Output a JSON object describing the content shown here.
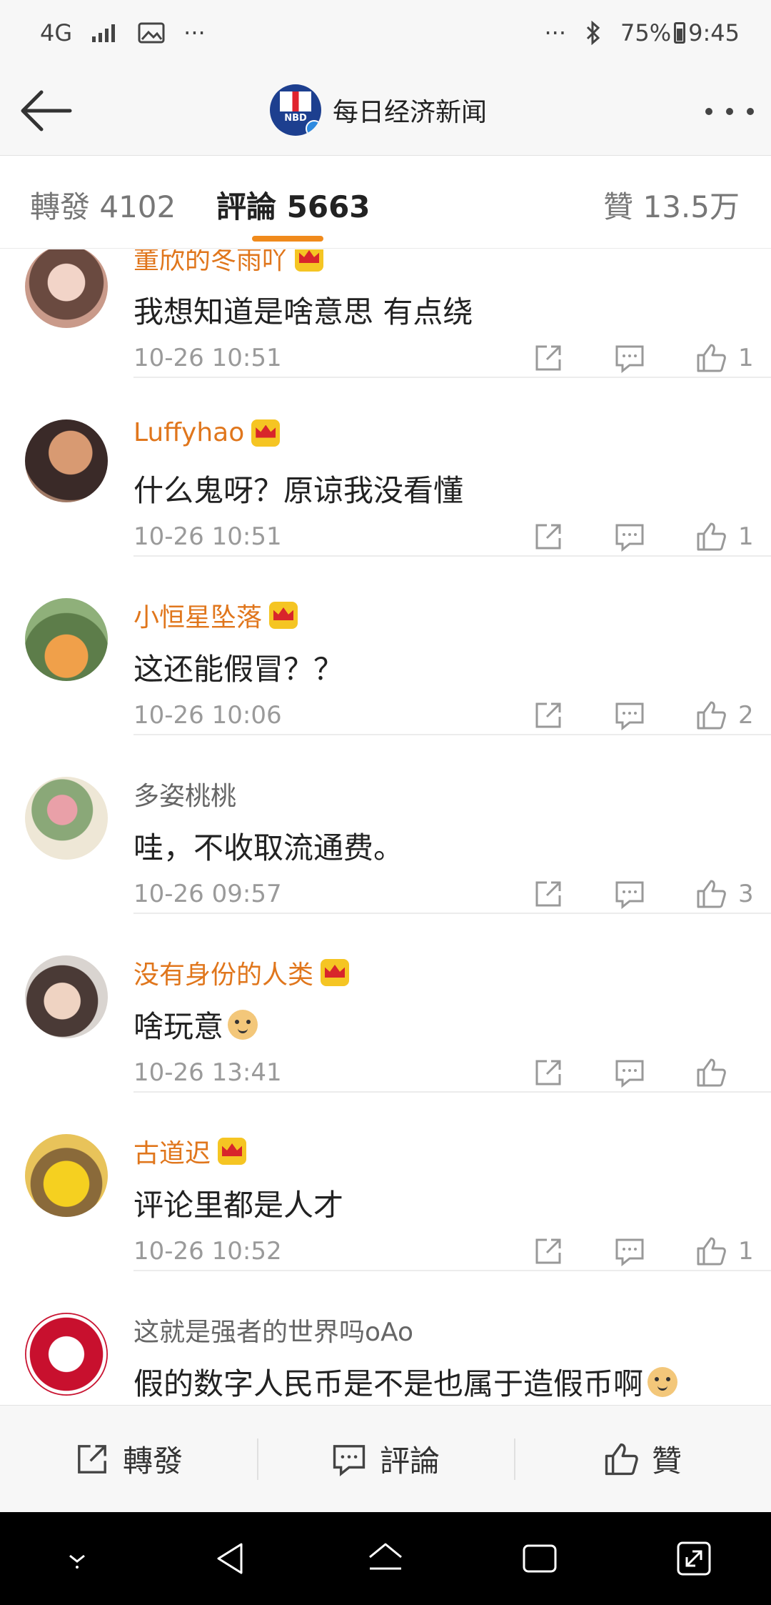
{
  "status_bar": {
    "network": "4G",
    "dots_left": "···",
    "dots_right": "···",
    "battery": "75%",
    "time": "9:45"
  },
  "header": {
    "logo_text": "NBD",
    "title": "每日经济新闻"
  },
  "tabs": [
    {
      "label": "轉發 4102"
    },
    {
      "label": "評論 5663"
    },
    {
      "label": "贊 13.5万"
    }
  ],
  "comments": [
    {
      "name": "董欣的冬雨吖",
      "vip": true,
      "text": "我想知道是啥意思 有点绕",
      "time": "10-26 10:51",
      "likes": "1",
      "emoji": false
    },
    {
      "name": "Luffyhao",
      "vip": true,
      "text": "什么鬼呀？原谅我没看懂",
      "time": "10-26 10:51",
      "likes": "1",
      "emoji": false
    },
    {
      "name": "小恒星坠落",
      "vip": true,
      "text": "这还能假冒？？",
      "time": "10-26 10:06",
      "likes": "2",
      "emoji": false
    },
    {
      "name": "多姿桃桃",
      "vip": false,
      "text": "哇，不收取流通费。",
      "time": "10-26 09:57",
      "likes": "3",
      "emoji": false
    },
    {
      "name": "没有身份的人类",
      "vip": true,
      "text": "啥玩意",
      "time": "10-26 13:41",
      "likes": "",
      "emoji": true
    },
    {
      "name": "古道迟",
      "vip": true,
      "text": "评论里都是人才",
      "time": "10-26 10:52",
      "likes": "1",
      "emoji": false
    },
    {
      "name": "这就是强者的世界吗oAo",
      "vip": false,
      "text": "假的数字人民币是不是也属于造假币啊",
      "time": "",
      "likes": "",
      "emoji": true
    }
  ],
  "action_bar": {
    "repost": "轉發",
    "comment": "評論",
    "like": "贊"
  },
  "colors": {
    "vip_name": "#e0761c",
    "tab_indicator": "#f08a1c",
    "meta_gray": "#9a9a9a"
  },
  "icons": [
    "back-arrow-icon",
    "more-icon",
    "crown-icon",
    "share-icon",
    "comment-icon",
    "like-icon",
    "dog-emoji-icon"
  ]
}
